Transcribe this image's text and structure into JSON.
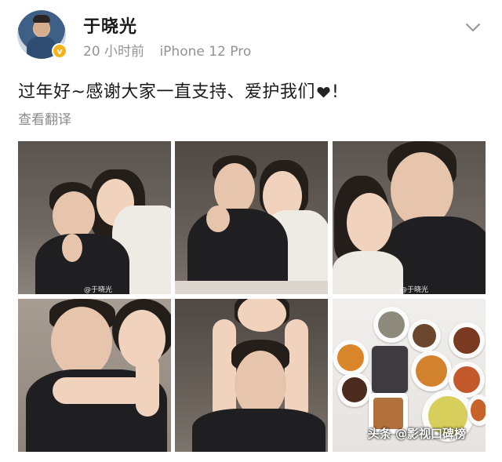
{
  "post": {
    "author": "于晓光",
    "time": "20 小时前",
    "device": "iPhone 12 Pro",
    "verified_badge": "v",
    "text_before_heart": "过年好~感谢大家一直支持、爱护我们",
    "text_after_heart": "!",
    "translate_label": "查看翻译",
    "heart_color": "#222222",
    "badge_color": "#f5b21b"
  },
  "images": {
    "count": 6,
    "watermark_1": "@于晓光",
    "watermark_3": "@于晓光"
  },
  "footer": {
    "watermark": "头条 @影视口碑榜"
  },
  "icons": {
    "more": "chevron-down-icon",
    "heart": "heart-icon",
    "verified": "verified-badge-icon"
  }
}
